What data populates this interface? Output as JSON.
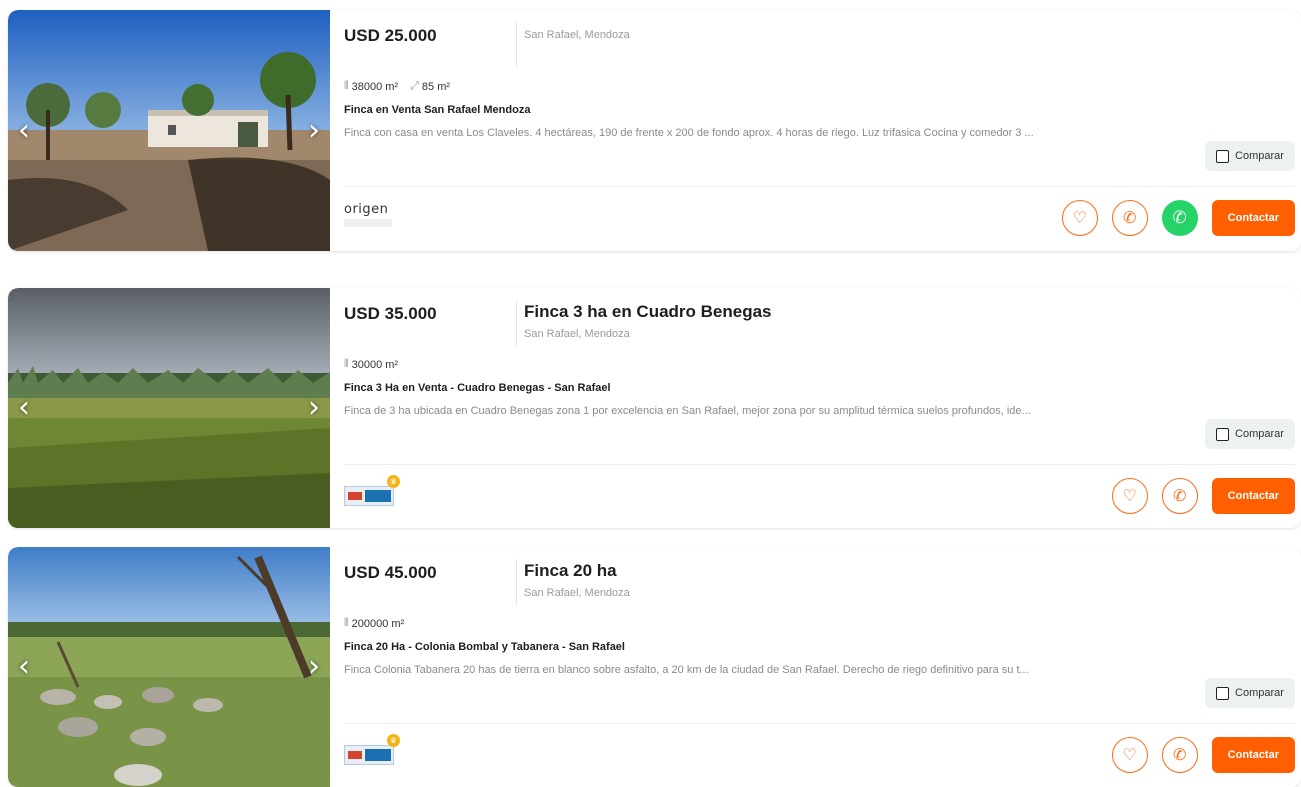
{
  "listings": [
    {
      "price": "USD 25.000",
      "title": "",
      "location": "San Rafael, Mendoza",
      "features": [
        {
          "icon": "land-area-icon",
          "value": "38000 m²"
        },
        {
          "icon": "covered-area-icon",
          "value": "85 m²"
        }
      ],
      "headline": "Finca en Venta San Rafael Mendoza",
      "description": "Finca con casa en venta Los Claveles. 4 hectáreas, 190 de frente x 200 de fondo aprox. 4 horas de riego. Luz trifasica Cocina y comedor 3 ...",
      "compare_label": "Comparar",
      "contact_label": "Contactar",
      "agency_logo_text": "origen",
      "has_whatsapp": true
    },
    {
      "price": "USD 35.000",
      "title": "Finca 3 ha en Cuadro Benegas",
      "location": "San Rafael, Mendoza",
      "features": [
        {
          "icon": "land-area-icon",
          "value": "30000 m²"
        }
      ],
      "headline": "Finca 3 Ha en Venta - Cuadro Benegas - San Rafael",
      "description": "Finca de 3 ha ubicada en Cuadro Benegas zona 1 por excelencia en San Rafael, mejor zona por su amplitud térmica suelos profundos, ide...",
      "compare_label": "Comparar",
      "contact_label": "Contactar",
      "has_whatsapp": false
    },
    {
      "price": "USD 45.000",
      "title": "Finca 20 ha",
      "location": "San Rafael, Mendoza",
      "features": [
        {
          "icon": "land-area-icon",
          "value": "200000 m²"
        }
      ],
      "headline": "Finca 20 Ha - Colonia Bombal y Tabanera - San Rafael",
      "description": "Finca Colonia Tabanera 20 has de tierra en blanco sobre asfalto, a 20 km de la ciudad de San Rafael. Derecho de riego definitivo para su t...",
      "compare_label": "Comparar",
      "contact_label": "Contactar",
      "has_whatsapp": false
    }
  ],
  "colors": {
    "accent": "#ff5f00",
    "whatsapp": "#25d366",
    "muted": "#9a9a9a"
  }
}
